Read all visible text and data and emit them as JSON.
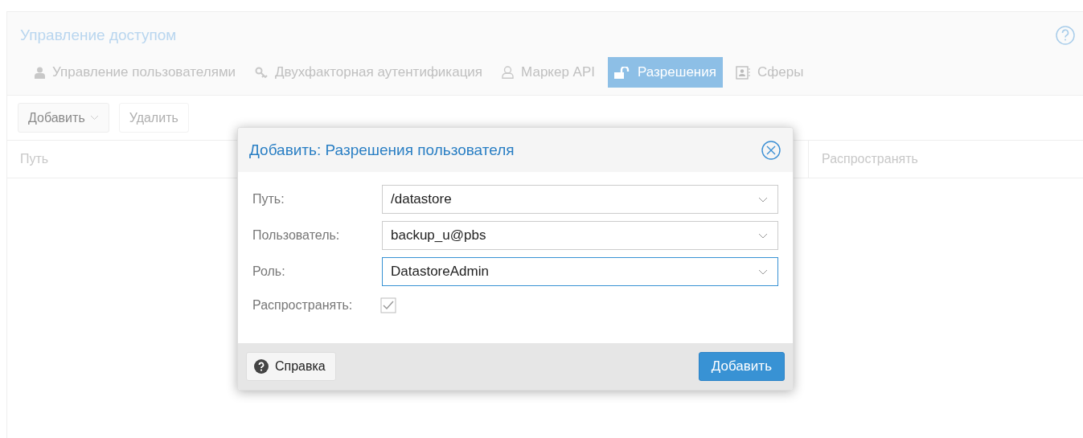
{
  "panel": {
    "title": "Управление доступом",
    "tabs": [
      {
        "label": "Управление пользователями",
        "selected": false
      },
      {
        "label": "Двухфакторная аутентификация",
        "selected": false
      },
      {
        "label": "Маркер API",
        "selected": false
      },
      {
        "label": "Разрешения",
        "selected": true
      },
      {
        "label": "Сферы",
        "selected": false
      }
    ],
    "toolbar": [
      {
        "label": "Добавить",
        "dropdown": true,
        "disabled": false
      },
      {
        "label": "Удалить",
        "dropdown": false,
        "disabled": true
      }
    ],
    "columns": [
      {
        "label": "Путь"
      },
      {
        "label": "Распространять"
      }
    ]
  },
  "dialog": {
    "title": "Добавить: Разрешения пользователя",
    "fields": [
      {
        "kind": "combo",
        "label": "Путь:",
        "value": "/datastore",
        "focused": false
      },
      {
        "kind": "combo",
        "label": "Пользователь:",
        "value": "backup_u@pbs",
        "focused": false
      },
      {
        "kind": "combo",
        "label": "Роль:",
        "value": "DatastoreAdmin",
        "focused": true
      },
      {
        "kind": "checkbox",
        "label": "Распространять:",
        "checked": true
      }
    ],
    "help_button": "Справка",
    "submit_button": "Добавить"
  }
}
